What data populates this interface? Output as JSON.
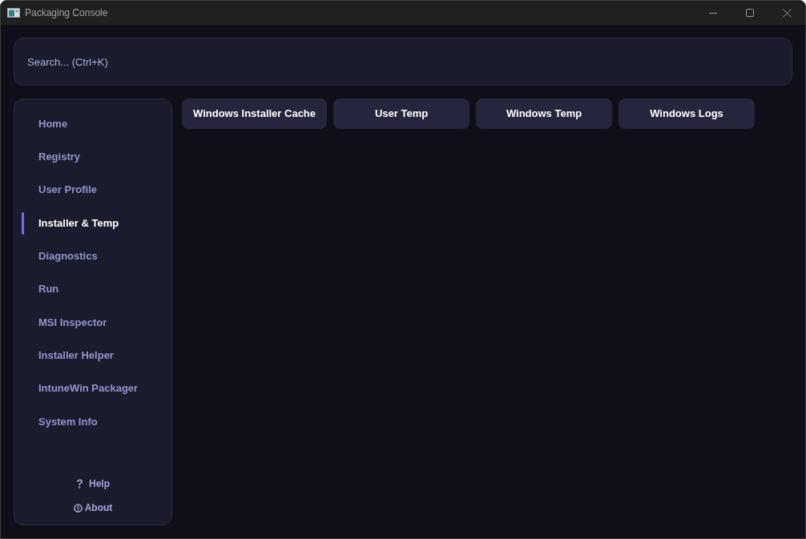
{
  "window": {
    "title": "Packaging Console"
  },
  "search": {
    "placeholder": "Search... (Ctrl+K)"
  },
  "sidebar": {
    "items": [
      {
        "label": "Home",
        "selected": false
      },
      {
        "label": "Registry",
        "selected": false
      },
      {
        "label": "User Profile",
        "selected": false
      },
      {
        "label": "Installer & Temp",
        "selected": true
      },
      {
        "label": "Diagnostics",
        "selected": false
      },
      {
        "label": "Run",
        "selected": false
      },
      {
        "label": "MSI Inspector",
        "selected": false
      },
      {
        "label": "Installer Helper",
        "selected": false
      },
      {
        "label": "IntuneWin Packager",
        "selected": false
      },
      {
        "label": "System Info",
        "selected": false
      }
    ],
    "footer_links": [
      {
        "kind": "help",
        "label": "Help"
      },
      {
        "kind": "info",
        "label": "About"
      }
    ]
  },
  "section_buttons": [
    {
      "label": "Windows Installer Cache"
    },
    {
      "label": "User Temp"
    },
    {
      "label": "Windows Temp"
    },
    {
      "label": "Windows Logs"
    }
  ]
}
